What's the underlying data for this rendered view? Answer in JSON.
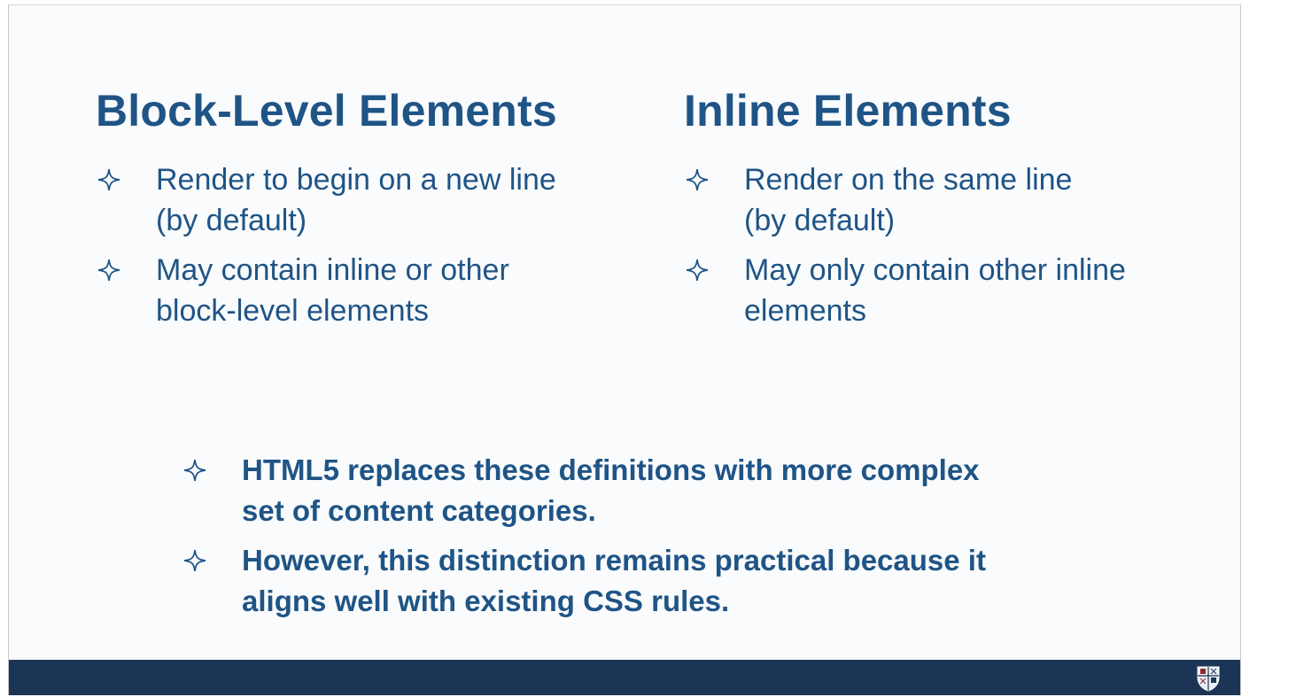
{
  "left_column": {
    "heading": "Block-Level Elements",
    "bullets": [
      {
        "line1": "Render to begin on a new line",
        "line2": "(by default)"
      },
      {
        "line1": "May contain inline or other",
        "line2": "block-level elements"
      }
    ]
  },
  "right_column": {
    "heading": "Inline Elements",
    "bullets": [
      {
        "line1": "Render on the same line",
        "line2": "(by default)"
      },
      {
        "line1": "May only contain other inline",
        "line2": "elements"
      }
    ]
  },
  "notes": [
    {
      "line1": "HTML5 replaces these definitions with more complex",
      "line2": "set of content categories."
    },
    {
      "line1": "However, this distinction remains practical because it",
      "line2": "aligns well with existing CSS rules."
    }
  ],
  "footer": {
    "logo_icon": "university-shield-icon"
  },
  "colors": {
    "text": "#1f5486",
    "footer_bar": "#1c3557",
    "background": "#fafbfc"
  }
}
